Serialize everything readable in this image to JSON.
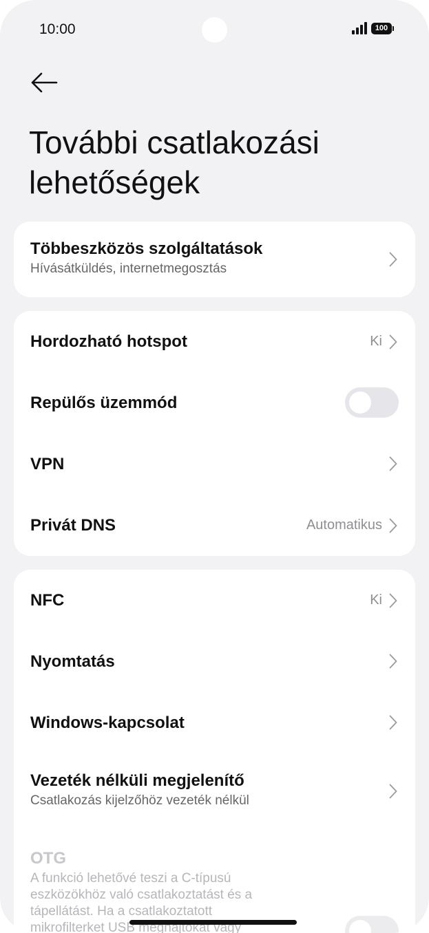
{
  "status": {
    "time": "10:00",
    "battery": "100"
  },
  "title": "További csatlakozási lehetőségek",
  "card1": {
    "multi": {
      "label": "Többeszközös szolgáltatások",
      "sub": "Hívásátküldés, internetmegosztás"
    }
  },
  "card2": {
    "hotspot": {
      "label": "Hordozható hotspot",
      "value": "Ki"
    },
    "airplane": {
      "label": "Repülős üzemmód",
      "toggle_on": false
    },
    "vpn": {
      "label": "VPN"
    },
    "dns": {
      "label": "Privát DNS",
      "value": "Automatikus"
    }
  },
  "card3": {
    "nfc": {
      "label": "NFC",
      "value": "Ki"
    },
    "print": {
      "label": "Nyomtatás"
    },
    "windows": {
      "label": "Windows-kapcsolat"
    },
    "display": {
      "label": "Vezeték nélküli megjelenítő",
      "sub": "Csatlakozás kijelzőhöz vezeték nélkül"
    },
    "otg": {
      "label": "OTG",
      "sub": "A funkció lehetővé teszi a C-típusú eszközökhöz való csatlakoztatást és a tápellátást. Ha a csatlakoztatott",
      "sub_cut": "mikrofilterket USB meghajtókat vagy"
    }
  },
  "colors": {
    "background": "#f2f2f4",
    "card": "#ffffff",
    "toggle_off": "#e5e5ea",
    "secondary_text": "#8e8e93"
  }
}
